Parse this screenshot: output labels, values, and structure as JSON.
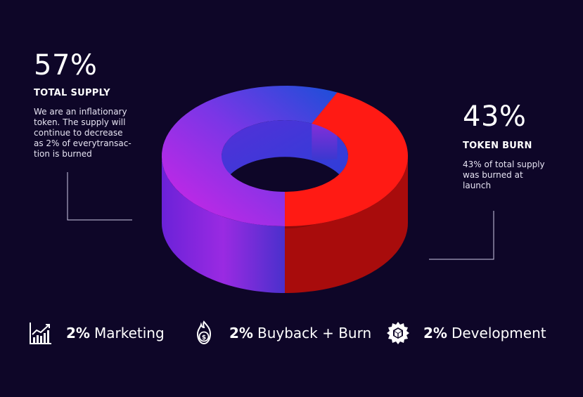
{
  "left": {
    "percent": "57%",
    "heading": "TOTAL SUPPLY",
    "desc_lines": [
      "We are an inflationary",
      "token. The supply will",
      "continue to decrease",
      "as 2% of everytransac-",
      "tion is burned"
    ]
  },
  "right": {
    "percent": "43%",
    "heading": "TOKEN BURN",
    "desc_lines": [
      "43% of total supply",
      "was burned at",
      "launch"
    ]
  },
  "bottom": [
    {
      "value": "2%",
      "label": "Marketing",
      "icon": "growth-chart-icon"
    },
    {
      "value": "2%",
      "label": "Buyback + Burn",
      "icon": "money-fire-icon"
    },
    {
      "value": "2%",
      "label": "Development",
      "icon": "gear-cube-icon"
    }
  ],
  "colors": {
    "background": "#0e0628",
    "supply_top_start": "#cc22e0",
    "supply_top_end": "#1d4fd6",
    "burn_top": "#ff1a14",
    "burn_side": "#a80c0c"
  },
  "chart_data": {
    "type": "pie",
    "style": "3d-donut",
    "slices": [
      {
        "label": "TOTAL SUPPLY",
        "value": 57
      },
      {
        "label": "TOKEN BURN",
        "value": 43
      }
    ]
  }
}
